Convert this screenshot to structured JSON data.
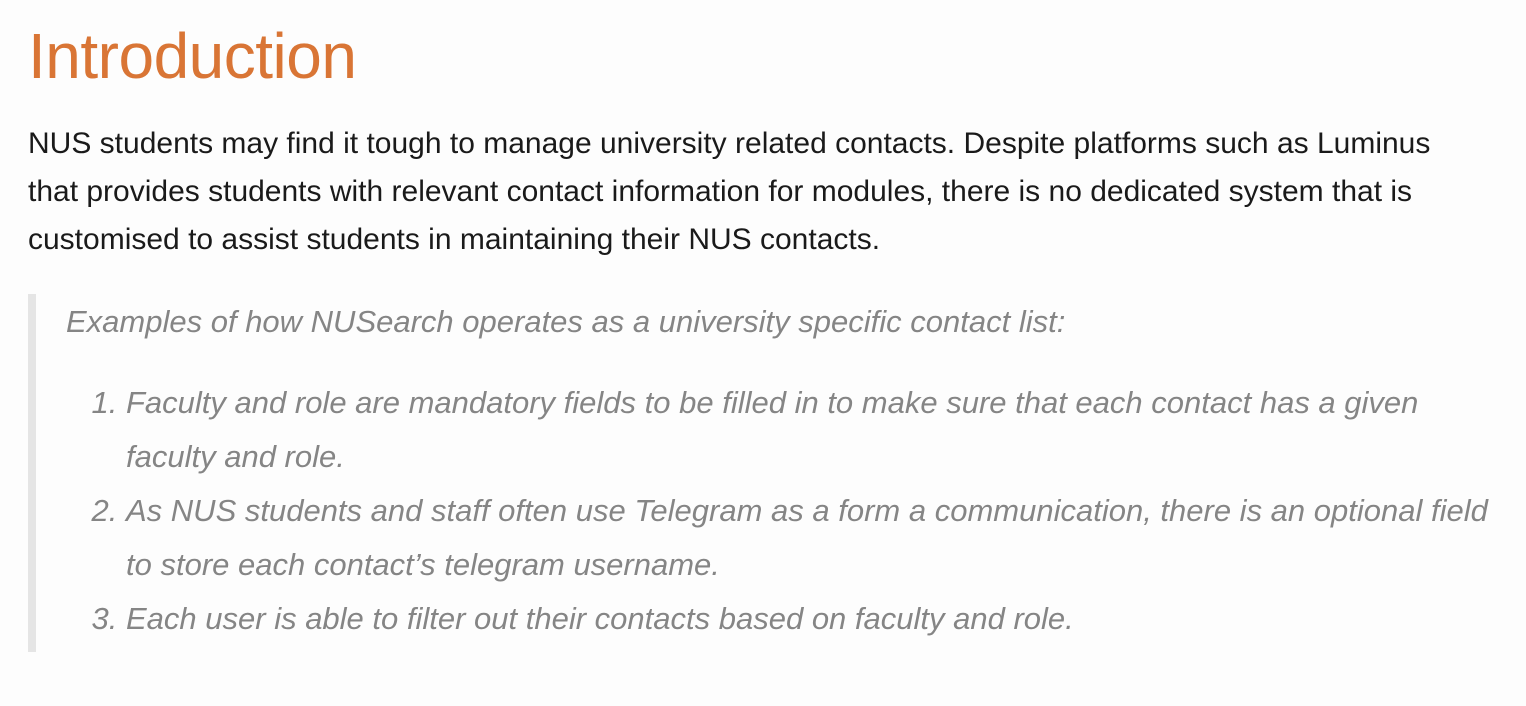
{
  "section": {
    "title": "Introduction",
    "intro": "NUS students may find it tough to manage university related contacts. Despite platforms such as Luminus that provides students with relevant contact information for modules, there is no dedicated system that is customised to assist students in maintaining their NUS contacts."
  },
  "blockquote": {
    "lead": "Examples of how NUSearch operates as a university specific contact list:",
    "items": [
      "Faculty and role are mandatory fields to be filled in to make sure that each contact has a given faculty and role.",
      "As NUS students and staff often use Telegram as a form a communication, there is an optional field to store each contact’s telegram username.",
      "Each user is able to filter out their contacts based on faculty and role."
    ]
  },
  "colors": {
    "heading": "#d97535",
    "body_text": "#1a1a1a",
    "quote_text": "#858585",
    "quote_border": "#e5e5e5",
    "background": "#fdfdfd"
  }
}
